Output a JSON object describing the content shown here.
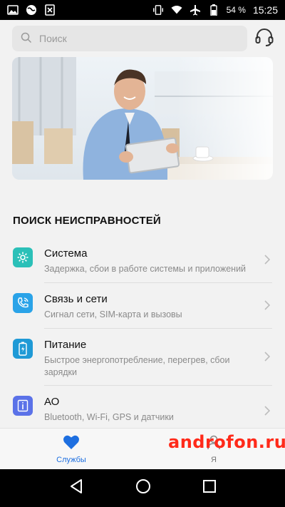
{
  "status_bar": {
    "battery_percent": "54 %",
    "time": "15:25",
    "icons_left": [
      "image-icon",
      "globe-icon",
      "sim-x-icon"
    ],
    "icons_right": [
      "vibrate-icon",
      "wifi-icon",
      "airplane-icon",
      "battery-icon"
    ]
  },
  "search": {
    "placeholder": "Поиск"
  },
  "section": {
    "title": "ПОИСК НЕИСПРАВНОСТЕЙ"
  },
  "items": [
    {
      "title": "Система",
      "subtitle": "Задержка, сбои в работе системы и приложений",
      "icon": "gear-icon",
      "color": "#2bc0b8"
    },
    {
      "title": "Связь и сети",
      "subtitle": "Сигнал сети, SIM-карта и вызовы",
      "icon": "phone-wave-icon",
      "color": "#2aa3e8"
    },
    {
      "title": "Питание",
      "subtitle": "Быстрое энергопотребление, перегрев, сбои зарядки",
      "icon": "battery-charge-icon",
      "color": "#1f9ad6"
    },
    {
      "title": "АО",
      "subtitle": "Bluetooth, Wi-Fi, GPS и датчики",
      "icon": "info-icon",
      "color": "#5b72e8"
    }
  ],
  "tabs": [
    {
      "label": "Службы",
      "icon": "heart-icon",
      "active": true
    },
    {
      "label": "Я",
      "icon": "person-icon",
      "active": false
    }
  ],
  "watermark": "androfon.ru",
  "colors": {
    "accent": "#1e6fe0",
    "background": "#f2f2f2"
  }
}
